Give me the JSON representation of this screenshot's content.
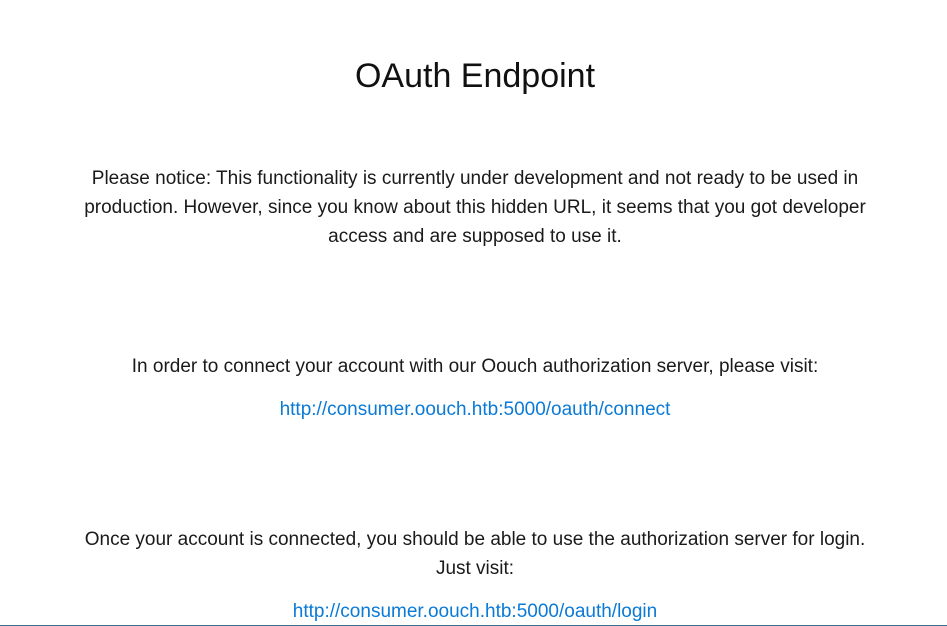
{
  "page": {
    "title": "OAuth Endpoint",
    "notice": "Please notice: This functionality is currently under development and not ready to be used in production. However, since you know about this hidden URL, it seems that you got developer access and are supposed to use it.",
    "connect": {
      "text": "In order to connect your account with our Oouch authorization server, please visit:",
      "link": "http://consumer.oouch.htb:5000/oauth/connect"
    },
    "login": {
      "text": "Once your account is connected, you should be able to use the authorization server for login. Just visit:",
      "link": "http://consumer.oouch.htb:5000/oauth/login"
    }
  },
  "colors": {
    "link": "#0a7ad6",
    "text": "#1a1a1a"
  }
}
